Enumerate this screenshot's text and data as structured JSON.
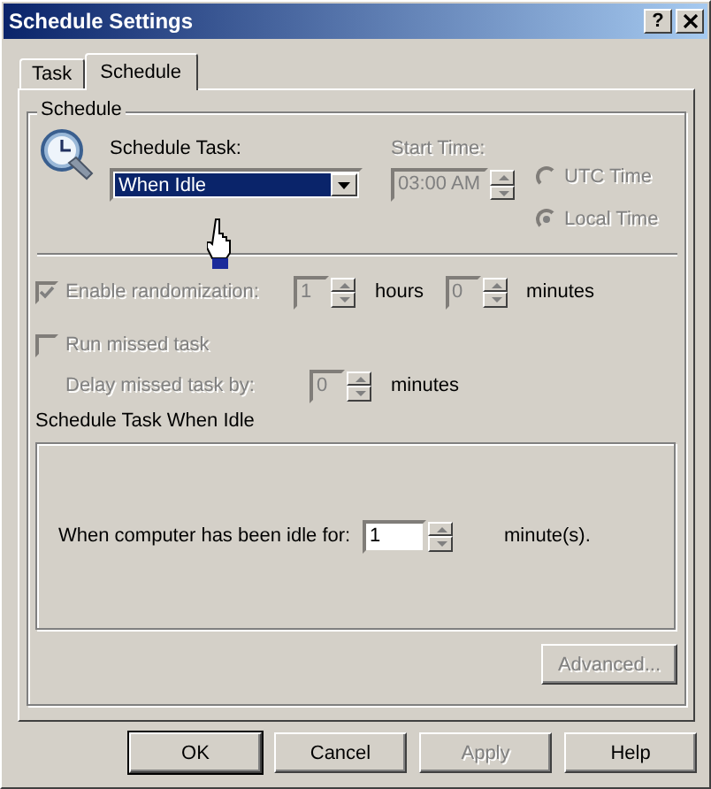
{
  "window": {
    "title": "Schedule Settings",
    "help_button": "?"
  },
  "tabs": [
    {
      "label": "Task",
      "selected": false
    },
    {
      "label": "Schedule",
      "selected": true
    }
  ],
  "schedule_group": {
    "title": "Schedule",
    "schedule_task": {
      "label": "Schedule Task:",
      "value": "When Idle"
    },
    "start_time": {
      "label": "Start Time:",
      "value": "03:00 AM",
      "disabled": true
    },
    "time_zone": [
      {
        "label": "UTC Time",
        "selected": false,
        "disabled": true
      },
      {
        "label": "Local Time",
        "selected": true,
        "disabled": true
      }
    ]
  },
  "randomization": {
    "label": "Enable randomization:",
    "checked": true,
    "disabled": true,
    "hours": {
      "value": "1",
      "unit": "hours"
    },
    "minutes": {
      "value": "0",
      "unit": "minutes"
    }
  },
  "run_missed_task": {
    "label": "Run missed task",
    "checked": false,
    "disabled": true
  },
  "delay": {
    "label": "Delay missed task by:",
    "value": "0",
    "unit": "minutes",
    "disabled": true
  },
  "idle_section": {
    "title": "Schedule Task When Idle",
    "label": "When computer has been idle for:",
    "value": "1",
    "unit": "minute(s)."
  },
  "advanced_button": {
    "label": "Advanced...",
    "disabled": true
  },
  "buttons": [
    {
      "label": "OK",
      "default": true,
      "disabled": false
    },
    {
      "label": "Cancel",
      "default": false,
      "disabled": false
    },
    {
      "label": "Apply",
      "default": false,
      "disabled": true
    },
    {
      "label": "Help",
      "default": false,
      "disabled": false
    }
  ]
}
